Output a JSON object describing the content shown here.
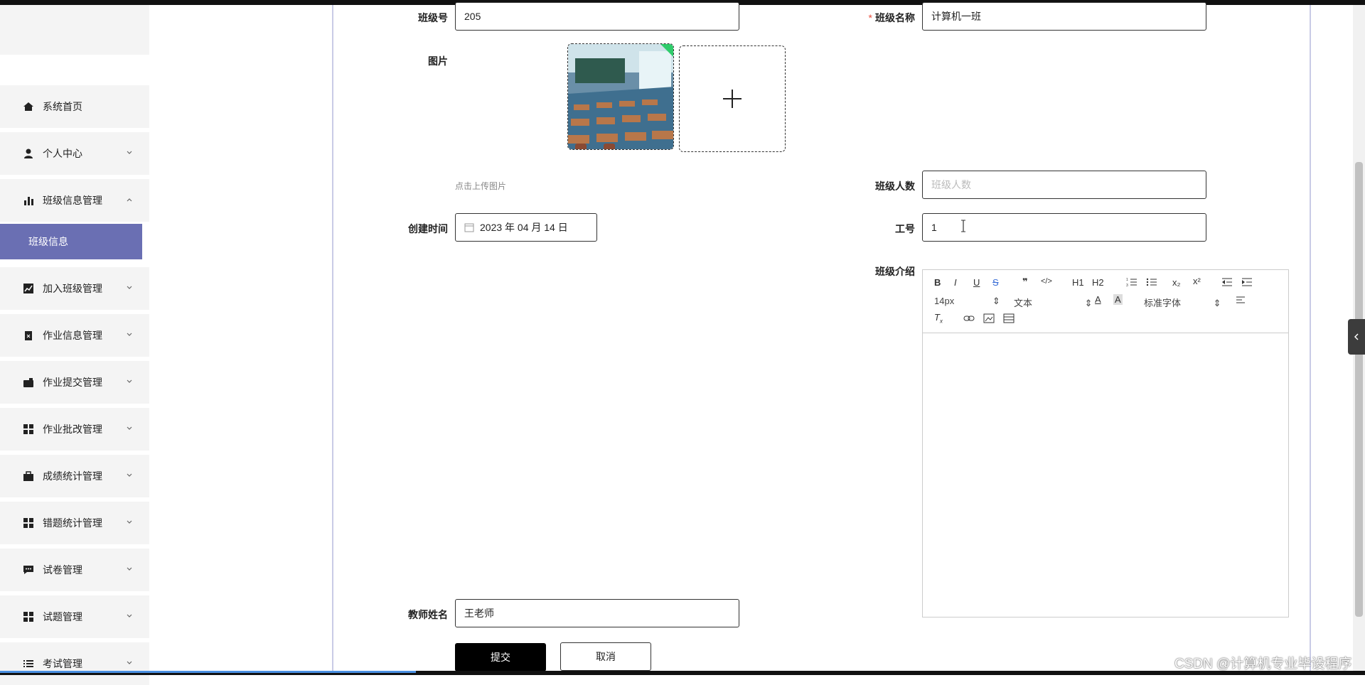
{
  "sidebar": {
    "items": [
      {
        "label": "系统首页",
        "icon": "home-icon",
        "expandable": false
      },
      {
        "label": "个人中心",
        "icon": "user-icon",
        "expandable": true
      },
      {
        "label": "班级信息管理",
        "icon": "bar-chart-icon",
        "expandable": true,
        "expanded": true
      },
      {
        "label": "加入班级管理",
        "icon": "line-chart-icon",
        "expandable": true
      },
      {
        "label": "作业信息管理",
        "icon": "clipboard-icon",
        "expandable": true
      },
      {
        "label": "作业提交管理",
        "icon": "wallet-icon",
        "expandable": true
      },
      {
        "label": "作业批改管理",
        "icon": "grid-icon",
        "expandable": true
      },
      {
        "label": "成绩统计管理",
        "icon": "briefcase-icon",
        "expandable": true
      },
      {
        "label": "错题统计管理",
        "icon": "grid-icon",
        "expandable": true
      },
      {
        "label": "试卷管理",
        "icon": "message-icon",
        "expandable": true
      },
      {
        "label": "试题管理",
        "icon": "grid-icon",
        "expandable": true
      },
      {
        "label": "考试管理",
        "icon": "list-icon",
        "expandable": true
      }
    ],
    "active_sub": "班级信息"
  },
  "form": {
    "class_no": {
      "label": "班级号",
      "value": "205"
    },
    "class_name": {
      "label": "班级名称",
      "value": "计算机一班",
      "required_mark": "*"
    },
    "image": {
      "label": "图片",
      "hint": "点击上传图片",
      "add_icon": "plus-icon"
    },
    "class_size": {
      "label": "班级人数",
      "placeholder": "班级人数"
    },
    "created_at": {
      "label": "创建时间",
      "value": "2023 年 04 月 14 日",
      "icon": "calendar-icon"
    },
    "staff_no": {
      "label": "工号",
      "value": "1"
    },
    "intro": {
      "label": "班级介绍"
    },
    "teacher_name": {
      "label": "教师姓名",
      "value": "王老师"
    }
  },
  "editor": {
    "toolbar_row1": [
      "B",
      "I",
      "U",
      "S",
      "❞",
      "</>",
      "H1",
      "H2",
      "ol",
      "ul",
      "x₂",
      "x²",
      "outdent",
      "indent"
    ],
    "font_size": "14px",
    "header_select": "文本",
    "font_family": "标准字体",
    "toolbar_row3": [
      "clean",
      "link",
      "image",
      "video"
    ]
  },
  "buttons": {
    "submit": "提交",
    "cancel": "取消"
  },
  "watermark": "CSDN @计算机专业毕设程序"
}
